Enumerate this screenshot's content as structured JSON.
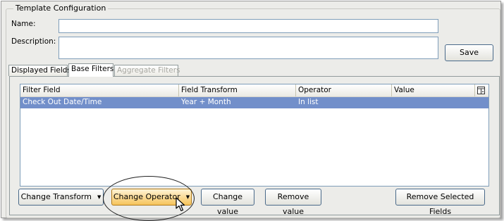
{
  "group": {
    "title": "Template Configuration"
  },
  "form": {
    "name_label": "Name:",
    "name_value": "",
    "description_label": "Description:",
    "description_value": "",
    "save_label": "Save"
  },
  "tabs": [
    {
      "label": "Displayed Fields",
      "state": "normal"
    },
    {
      "label": "Base Filters",
      "state": "active"
    },
    {
      "label": "Aggregate Filters",
      "state": "disabled"
    }
  ],
  "grid": {
    "columns": [
      "Filter Field",
      "Field Transform",
      "Operator",
      "Value"
    ],
    "column_chooser_icon": "column-chooser-icon",
    "rows": [
      {
        "filter_field": "Check Out Date/Time",
        "field_transform": "Year + Month",
        "operator": "In list",
        "value": "",
        "selected": true
      }
    ],
    "selection_color": "#728fca"
  },
  "buttons": {
    "change_transform": "Change Transform",
    "change_operator": "Change Operator",
    "change_value": "Change value",
    "remove_value": "Remove value",
    "remove_selected_fields": "Remove Selected Fields"
  },
  "cursor": "mouse-pointer-icon"
}
